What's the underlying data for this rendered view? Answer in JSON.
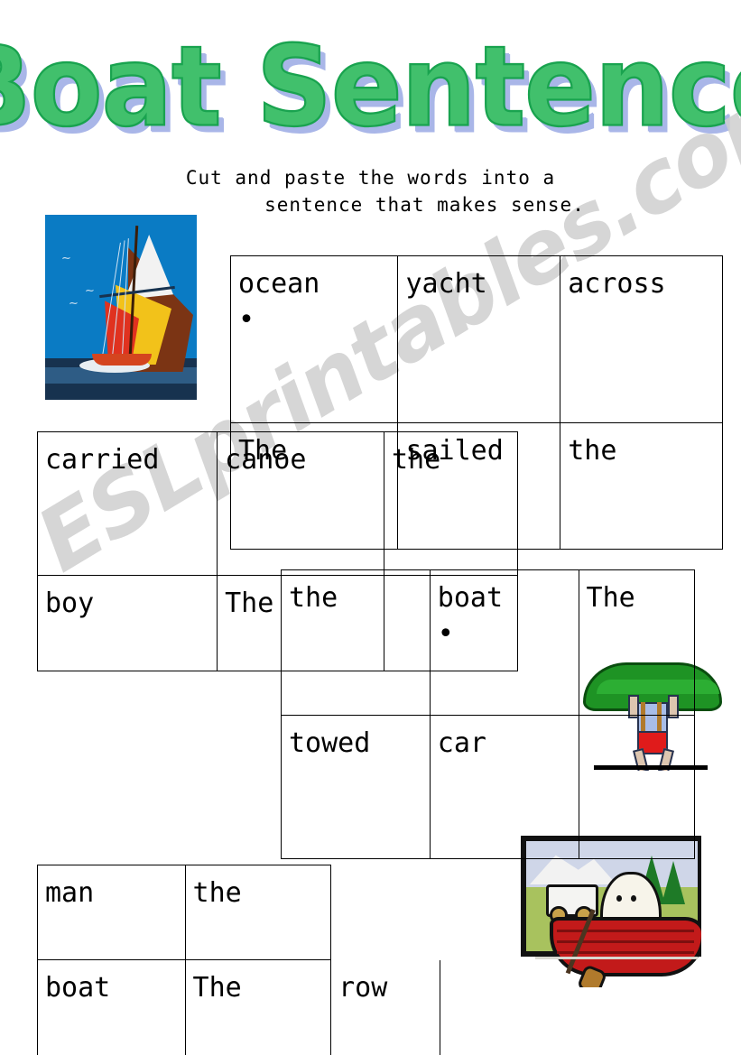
{
  "page": {
    "title": "Boat Sentences",
    "subtitle_line1": "Cut and paste the words into a",
    "subtitle_line2": "sentence that makes sense.",
    "watermark": "ESLprintables.com",
    "title_color": "#41c06c",
    "title_outline_color": "#19a34f",
    "title_shadow_color": "#a9b6e8",
    "watermark_color": "#cfcfcf",
    "text_color": "#000000",
    "border_color": "#000000",
    "background_color": "#ffffff"
  },
  "images": {
    "sailboat": {
      "name": "sailboat-yacht-clipart",
      "sky_color": "#0a7bc4",
      "sea_color": "#17324f",
      "sail_colors": [
        "#f2f2f2",
        "#f2c21a",
        "#e0321f",
        "#7b3414"
      ],
      "birds": [
        "⸺",
        "⸺",
        "⸺"
      ]
    },
    "canoe_carrier": {
      "name": "person-carrying-canoe-clipart",
      "canoe_color": "#1e9324",
      "shirt_color": "#a8bde8",
      "shorts_color": "#e01b1b"
    },
    "rowboat": {
      "name": "person-rowing-boat-clipart",
      "boat_color": "#c21a1a",
      "scene_color": "#a8c25e"
    }
  },
  "tables": [
    {
      "id": "table-1",
      "name": "word-table-ocean-yacht-across",
      "rows": [
        [
          "ocean",
          "yacht",
          "across"
        ],
        [
          "The",
          "sailed",
          "the"
        ]
      ],
      "dots": [
        [
          true,
          false,
          false
        ],
        [
          false,
          false,
          false
        ]
      ]
    },
    {
      "id": "table-2",
      "name": "word-table-carried-canoe-the",
      "rows": [
        [
          "carried",
          "canoe",
          "the"
        ],
        [
          "boy",
          "The",
          ""
        ]
      ],
      "dots": [
        [
          false,
          false,
          false
        ],
        [
          false,
          false,
          false
        ]
      ]
    },
    {
      "id": "table-3",
      "name": "word-table-the-boat-the",
      "rows": [
        [
          "the",
          "boat",
          "The"
        ],
        [
          "towed",
          "car",
          ""
        ]
      ],
      "dots": [
        [
          false,
          true,
          false
        ],
        [
          false,
          false,
          false
        ]
      ]
    },
    {
      "id": "table-4",
      "name": "word-table-man-the-boat-the-row",
      "rows": [
        [
          "man",
          "the",
          ""
        ],
        [
          "boat",
          "The",
          "row"
        ]
      ],
      "dots": [
        [
          false,
          false,
          false
        ],
        [
          false,
          false,
          false
        ]
      ]
    }
  ]
}
